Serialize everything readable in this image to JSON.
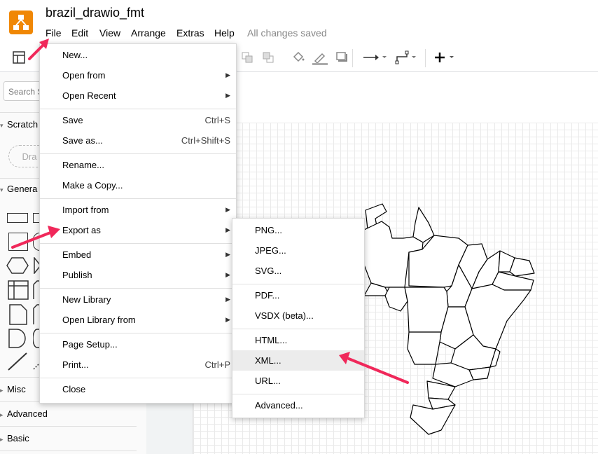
{
  "app": {
    "title": "brazil_drawio_fmt",
    "menubar": [
      "File",
      "Edit",
      "View",
      "Arrange",
      "Extras",
      "Help"
    ],
    "status": "All changes saved"
  },
  "sidebar": {
    "search_placeholder": "Search S",
    "sections": {
      "scratchpad": "Scratch",
      "drop_hint": "Dra",
      "general": "Genera",
      "misc": "Misc",
      "advanced": "Advanced",
      "basic": "Basic"
    }
  },
  "file_menu": {
    "new": "New...",
    "open_from": "Open from",
    "open_recent": "Open Recent",
    "save": "Save",
    "save_shortcut": "Ctrl+S",
    "save_as": "Save as...",
    "save_as_shortcut": "Ctrl+Shift+S",
    "rename": "Rename...",
    "make_copy": "Make a Copy...",
    "import_from": "Import from",
    "export_as": "Export as",
    "embed": "Embed",
    "publish": "Publish",
    "new_library": "New Library",
    "open_library_from": "Open Library from",
    "page_setup": "Page Setup...",
    "print": "Print...",
    "print_shortcut": "Ctrl+P",
    "close": "Close"
  },
  "export_menu": {
    "png": "PNG...",
    "jpeg": "JPEG...",
    "svg": "SVG...",
    "pdf": "PDF...",
    "vsdx": "VSDX (beta)...",
    "html": "HTML...",
    "xml": "XML...",
    "url": "URL...",
    "advanced": "Advanced..."
  },
  "colors": {
    "accent_arrow": "#f0285a",
    "logo": "#f08705",
    "highlight": "#ececec"
  }
}
